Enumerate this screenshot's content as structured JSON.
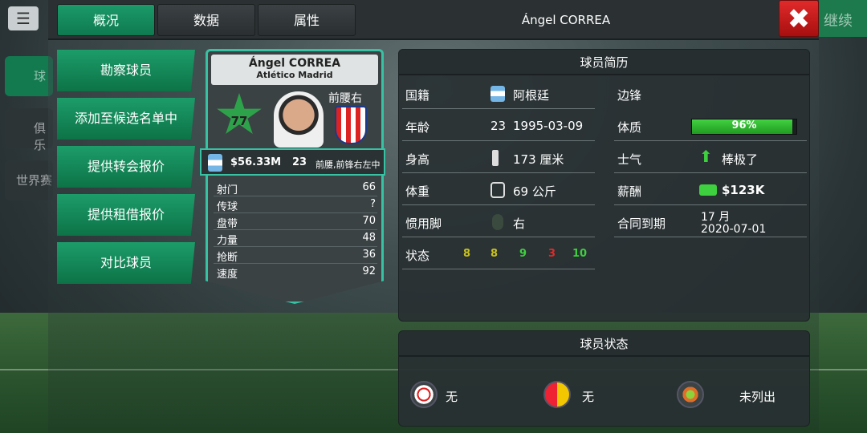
{
  "window": {
    "title": "Ángel CORREA"
  },
  "background": {
    "menu_icon": "menu-icon",
    "side_items": [
      "球",
      "俱乐",
      "世界赛"
    ],
    "continue_label": "继续"
  },
  "tabs": [
    {
      "label": "概况",
      "active": true
    },
    {
      "label": "数据",
      "active": false
    },
    {
      "label": "属性",
      "active": false
    }
  ],
  "actions": [
    "勘察球员",
    "添加至候选名单中",
    "提供转会报价",
    "提供租借报价",
    "对比球员"
  ],
  "card": {
    "name": "Ángel CORREA",
    "club": "Atlético Madrid",
    "rating": "77",
    "position": "前腰右",
    "value": "$56.33M",
    "age": "23",
    "positions": "前腰,前锋右左中",
    "attributes": [
      {
        "label": "射门",
        "value": "66"
      },
      {
        "label": "传球",
        "value": "?"
      },
      {
        "label": "盘带",
        "value": "70"
      },
      {
        "label": "力量",
        "value": "48"
      },
      {
        "label": "抢断",
        "value": "36"
      },
      {
        "label": "速度",
        "value": "92"
      }
    ]
  },
  "bio": {
    "header": "球员简历",
    "nationality": {
      "label": "国籍",
      "value": "阿根廷"
    },
    "age": {
      "label": "年龄",
      "age": "23",
      "dob": "1995-03-09"
    },
    "height": {
      "label": "身高",
      "value": "173 厘米"
    },
    "weight": {
      "label": "体重",
      "value": "69 公斤"
    },
    "foot": {
      "label": "惯用脚",
      "value": "右"
    },
    "form": {
      "label": "状态",
      "values": [
        "8",
        "8",
        "9",
        "3",
        "10"
      ],
      "colors": [
        "#c9c21c",
        "#c9c21c",
        "#3ed03e",
        "#e02a2a",
        "#3ed03e"
      ]
    },
    "role": {
      "label": "边锋"
    },
    "fitness": {
      "label": "体质",
      "value": "96%",
      "level": 0.96
    },
    "morale": {
      "label": "士气",
      "value": "棒极了"
    },
    "salary": {
      "label": "薪酬",
      "value": "$123K"
    },
    "contract": {
      "label": "合同到期",
      "remaining": "17 月",
      "date": "2020-07-01"
    }
  },
  "status": {
    "header": "球员状态",
    "injury": "无",
    "cards": "无",
    "listed": "未列出"
  },
  "colors": {
    "accent": "#1c9c69",
    "card_border": "#37c2a4",
    "close": "#e02a2a"
  }
}
